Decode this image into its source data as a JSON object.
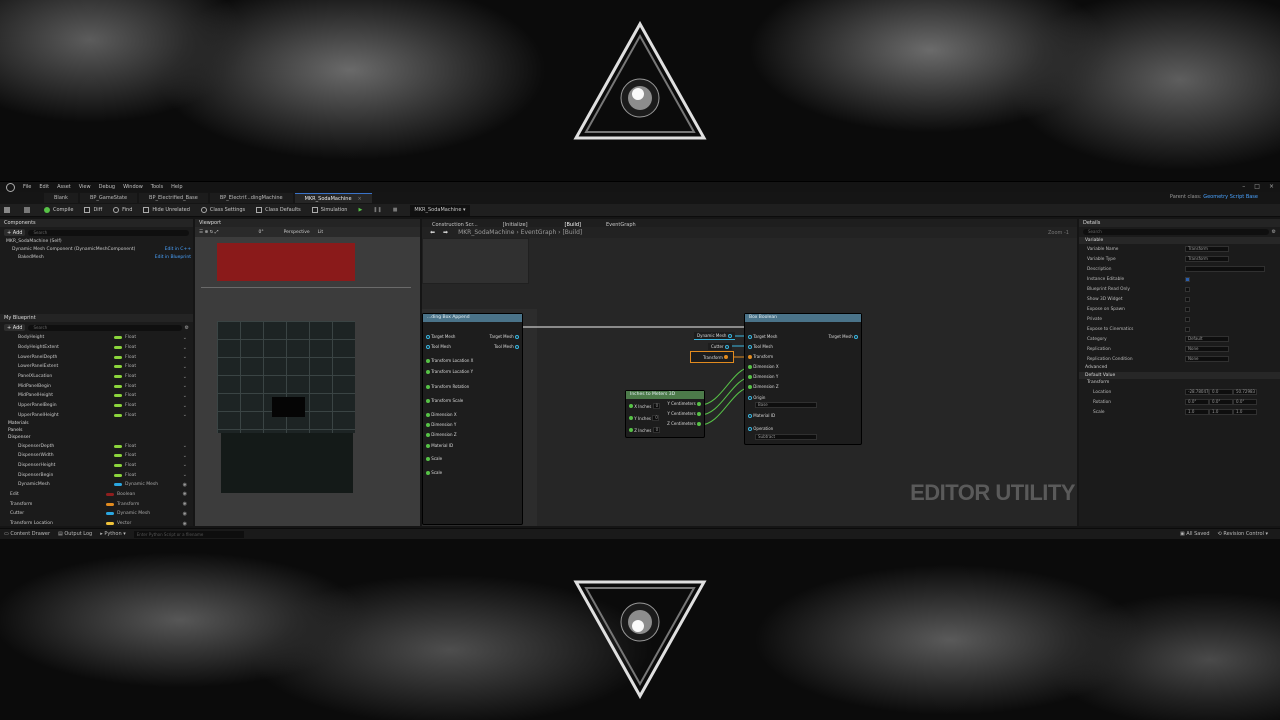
{
  "menu": [
    "File",
    "Edit",
    "Asset",
    "View",
    "Debug",
    "Window",
    "Tools",
    "Help"
  ],
  "tabs": [
    {
      "label": "Blank"
    },
    {
      "label": "BP_GameState"
    },
    {
      "label": "BP_Electrified_Base"
    },
    {
      "label": "BP_Electrif...dingMachine"
    },
    {
      "label": "MKR_SodaMachine"
    }
  ],
  "parent_class": {
    "label": "Parent class:",
    "value": "Geometry Script Base"
  },
  "toolbar": [
    "Compile",
    "Diff",
    "Find",
    "Hide Unrelated",
    "Class Settings",
    "Class Defaults",
    "Simulation"
  ],
  "debug_target": "MKR_SodaMachine",
  "components": {
    "title": "Components",
    "add": "+ Add",
    "search_placeholder": "Search",
    "root": "MKR_SodaMachine (Self)",
    "items": [
      {
        "label": "Dynamic Mesh Component (DynamicMeshComponent)",
        "action": "Edit in C++"
      },
      {
        "label": "BakedMesh",
        "action": "Edit in Blueprint"
      }
    ]
  },
  "viewport": {
    "title": "Viewport",
    "perspective": "Perspective",
    "lit": "Lit",
    "fov": "0°"
  },
  "my_blueprint": {
    "title": "My Blueprint",
    "add": "+ Add",
    "search_placeholder": "Search",
    "vars_top": [
      {
        "name": "BodyHeight",
        "type": "Float"
      },
      {
        "name": "BodyHeightExtent",
        "type": "Float"
      },
      {
        "name": "LowerPanelDepth",
        "type": "Float"
      },
      {
        "name": "LowerPanelExtent",
        "type": "Float"
      },
      {
        "name": "PanelXLocation",
        "type": "Float"
      },
      {
        "name": "MidPanelBegin",
        "type": "Float"
      },
      {
        "name": "MidPanelHeight",
        "type": "Float"
      },
      {
        "name": "UpperPanelBegin",
        "type": "Float"
      },
      {
        "name": "UpperPanelHeight",
        "type": "Float"
      }
    ],
    "categories": [
      "Materials",
      "Panels",
      "Dispenser"
    ],
    "vars_dispenser": [
      {
        "name": "DispenserDepth",
        "type": "Float"
      },
      {
        "name": "DispenserWidth",
        "type": "Float"
      },
      {
        "name": "DispenserHeight",
        "type": "Float"
      },
      {
        "name": "DispenserBegin",
        "type": "Float"
      },
      {
        "name": "DynamicMesh",
        "type": "Dynamic Mesh"
      }
    ],
    "vars_bottom": [
      {
        "name": "Edit",
        "type": "Boolean"
      },
      {
        "name": "Transform",
        "type": "Transform"
      },
      {
        "name": "Cutter",
        "type": "Dynamic Mesh"
      },
      {
        "name": "Transform Location",
        "type": "Vector"
      }
    ]
  },
  "graph_tabs": [
    "Construction Scr...",
    "[Initialize]",
    "[Build]",
    "EventGraph"
  ],
  "breadcrumb": [
    "MKR_SodaMachine",
    "EventGraph",
    "[Build]"
  ],
  "zoom": "Zoom -1",
  "nodes": {
    "append": {
      "title": "...ding Box Append",
      "pins_left": [
        "Target Mesh",
        "Tool Mesh",
        "Transform Location X",
        "Transform Location Y",
        "Transform Rotation",
        "Transform Scale",
        "Dimension X",
        "Dimension Y",
        "Dimension Z",
        "Material ID",
        "Scale",
        "Scale"
      ],
      "pins_right": [
        "Target Mesh",
        "Tool Mesh"
      ]
    },
    "boolean": {
      "title": "Box Boolean",
      "pins_left": [
        "Target Mesh",
        "Tool Mesh",
        "Transform",
        "Dimension X",
        "Dimension Y",
        "Dimension Z",
        "Origin",
        "Material ID",
        "Operation"
      ],
      "origin": "Base",
      "operation": "Subtract",
      "pins_right": [
        "Target Mesh"
      ]
    },
    "inches": {
      "title": "Inches to Meters 3D",
      "pins_left": [
        "X Inches",
        "Y Inches",
        "Z Inches"
      ],
      "pins_right": [
        "Y Centimeters",
        "Y Centimeters",
        "Z Centimeters"
      ],
      "values": [
        "0",
        "0",
        "0"
      ]
    },
    "vars": {
      "dynamic_mesh": "Dynamic Mesh",
      "cutter": "Cutter",
      "transform": "Transform"
    }
  },
  "watermark": "EDITOR UTILITY",
  "details": {
    "title": "Details",
    "search_placeholder": "Search",
    "section_variable": "Variable",
    "rows": [
      {
        "k": "Variable Name",
        "v": "Transform"
      },
      {
        "k": "Variable Type",
        "v": "Transform"
      },
      {
        "k": "Description",
        "v": ""
      },
      {
        "k": "Instance Editable",
        "v": "checked"
      },
      {
        "k": "Blueprint Read Only",
        "v": ""
      },
      {
        "k": "Show 3D Widget",
        "v": ""
      },
      {
        "k": "Expose on Spawn",
        "v": ""
      },
      {
        "k": "Private",
        "v": ""
      },
      {
        "k": "Expose to Cinematics",
        "v": ""
      },
      {
        "k": "Category",
        "v": "Default"
      },
      {
        "k": "Replication",
        "v": "None"
      },
      {
        "k": "Replication Condition",
        "v": "None"
      }
    ],
    "advanced": "Advanced",
    "section_default": "Default Value",
    "transform_label": "Transform",
    "location": {
      "label": "Location",
      "x": "-28.78047",
      "y": "0.0",
      "z": "50.72983"
    },
    "rotation": {
      "label": "Rotation",
      "x": "0.0°",
      "y": "0.0°",
      "z": "0.0°"
    },
    "scale": {
      "label": "Scale",
      "x": "1.0",
      "y": "1.0",
      "z": "1.0"
    }
  },
  "status": {
    "content_drawer": "Content Drawer",
    "output_log": "Output Log",
    "cmd": "Python",
    "cmd_placeholder": "Enter Python Script or a filename",
    "saved": "All Saved",
    "revision": "Revision Control"
  },
  "colors": {
    "float": "#8bd53c",
    "bool": "#8f1e1e",
    "transform": "#e28b1f",
    "dynmesh": "#2aa6e0",
    "vector": "#f0c23a",
    "accent": "#3a73c9"
  }
}
